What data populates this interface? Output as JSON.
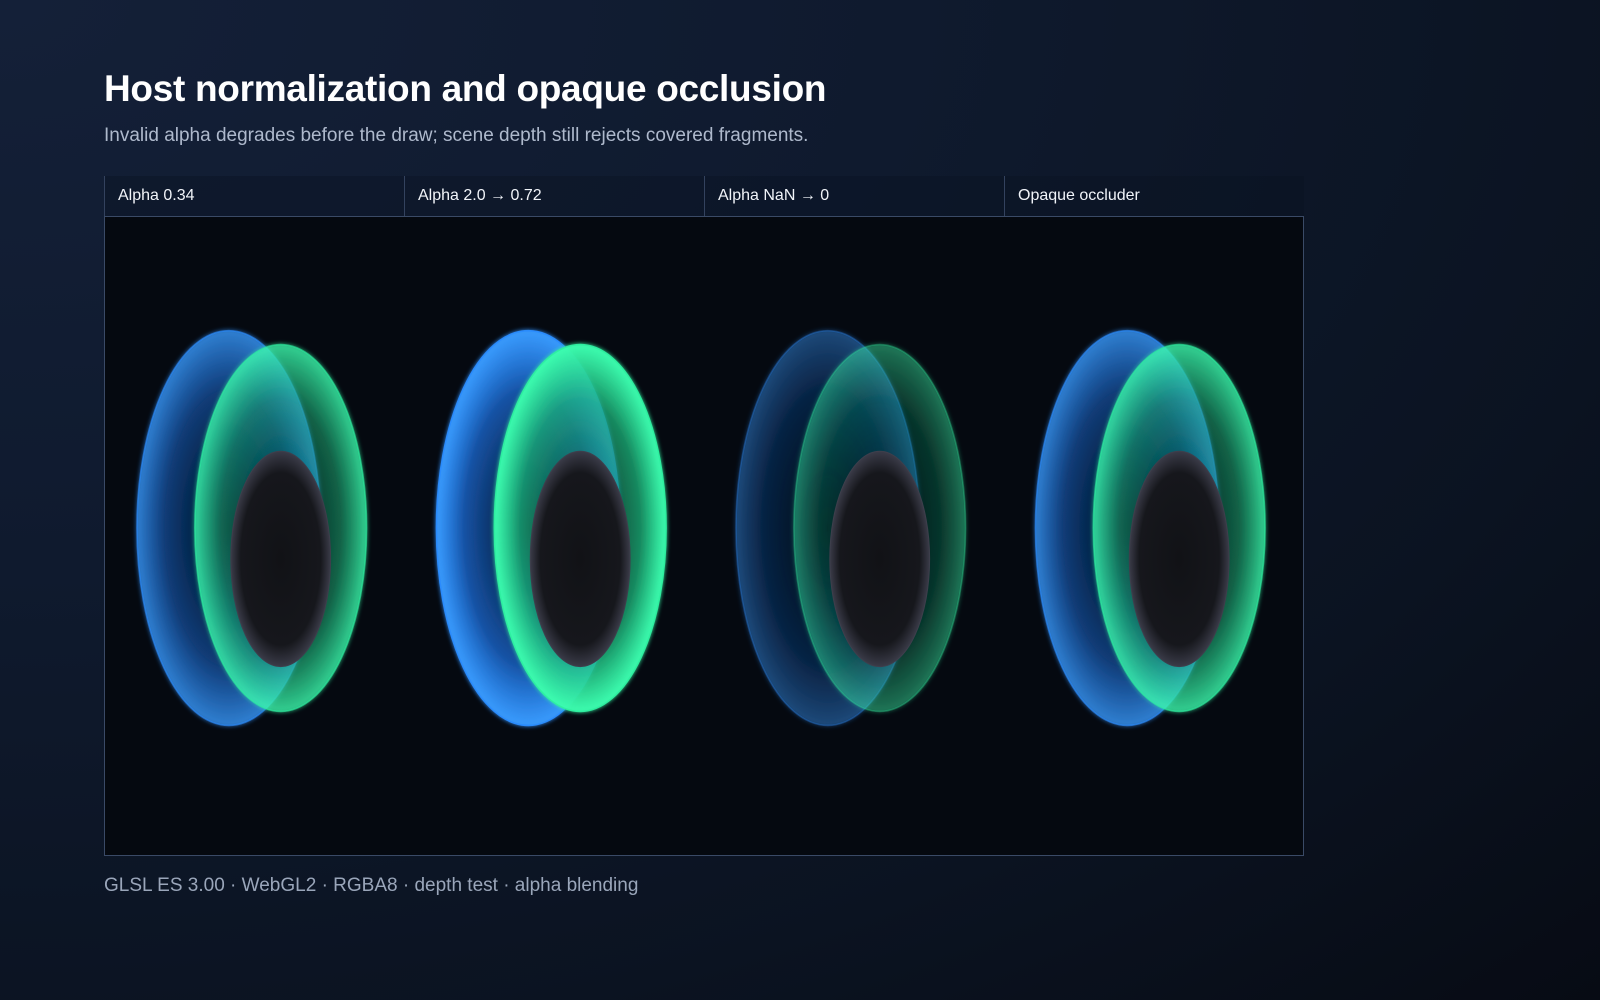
{
  "header": {
    "title": "Host normalization and opaque occlusion",
    "subtitle": "Invalid alpha degrades before the draw; scene depth still rejects covered fragments."
  },
  "panels": [
    {
      "label": "Alpha 0.34",
      "alpha": 0.34
    },
    {
      "label": "Alpha 2.0 → 0.72",
      "alpha": 0.72
    },
    {
      "label": "Alpha NaN → 0",
      "alpha": 0
    },
    {
      "label": "Opaque occluder",
      "alpha": 0.34
    }
  ],
  "footer": {
    "text": "GLSL ES 3.00 · WebGL2 · RGBA8 · depth test · alpha blending"
  },
  "colors": {
    "background": "#0f1a2e",
    "viewport_background": "#050910",
    "blue_shell": "#2a8cff",
    "green_shell": "#2df0a0",
    "occluder": "#131418"
  }
}
